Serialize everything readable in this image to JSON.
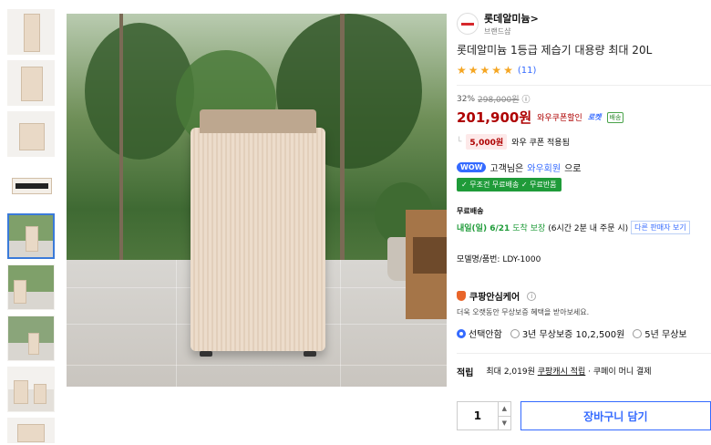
{
  "brand": {
    "name": "롯데알미늄",
    "arrow": ">",
    "sub": "브랜드샵"
  },
  "product": {
    "title": "롯데알미늄 1등급 제습기 대용량 최대 20L"
  },
  "rating": {
    "stars": 5,
    "count": "(11)"
  },
  "price": {
    "discount": "32%",
    "original": "298,000원",
    "info": "ⓘ",
    "sale": "201,900원",
    "coupon_label": "와우쿠폰할인",
    "rocket": "로켓",
    "rocket_badge": "배송"
  },
  "coupon": {
    "amount": "5,000원",
    "text": "와우 쿠폰 적용됨"
  },
  "wow": {
    "pill": "WOW",
    "text_before": "고객님은",
    "link": "와우회원",
    "text_after": "으로"
  },
  "shipping": {
    "badge": "✓ 무조건 무료배송 ✓ 무료반품"
  },
  "delivery": {
    "label": "무료배송",
    "date": "내일(일) 6/21",
    "guarantee": "도착 보장",
    "note": "(6시간 2분 내 주문 시)",
    "other_seller": "다른 판매자 보기"
  },
  "model": {
    "text": "모델명/품번: LDY-1000"
  },
  "care": {
    "title": "쿠팡안심케어",
    "desc": "더욱 오랫동안 무상보증 혜택을 받아보세요.",
    "options": [
      "선택안함",
      "3년 무상보증 10,2,500원",
      "5년 무상보"
    ]
  },
  "points": {
    "label": "적립",
    "max": "최대 2,019원",
    "link": "쿠팡캐시 적립",
    "rest": "· 쿠페이 머니 결제"
  },
  "cart": {
    "qty": "1",
    "button": "장바구니 담기"
  },
  "colors": {
    "accent": "#346aff",
    "price": "#ae0000",
    "green": "#1f9b39"
  }
}
